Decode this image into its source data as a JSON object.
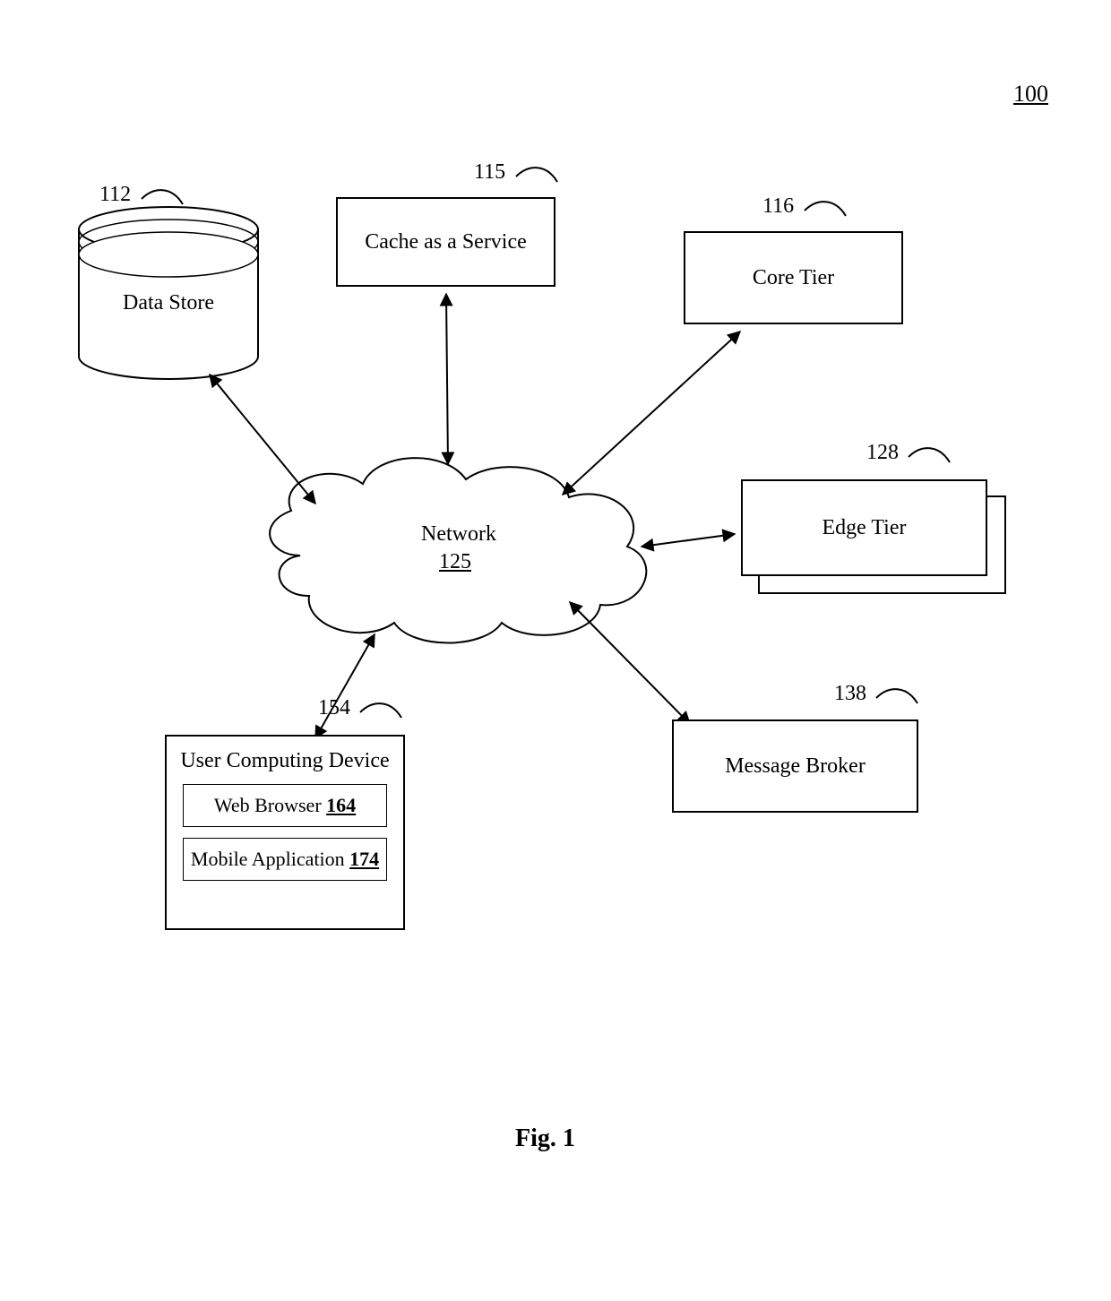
{
  "figure_ref": "100",
  "caption": "Fig. 1",
  "network": {
    "label": "Network",
    "ref": "125"
  },
  "nodes": {
    "data_store": {
      "ref": "112",
      "label": "Data Store"
    },
    "cache": {
      "ref": "115",
      "label": "Cache as a Service"
    },
    "core": {
      "ref": "116",
      "label": "Core Tier"
    },
    "edge": {
      "ref": "128",
      "label": "Edge Tier"
    },
    "broker": {
      "ref": "138",
      "label": "Message Broker"
    },
    "user_device": {
      "ref": "154",
      "label": "User Computing Device"
    },
    "web_browser": {
      "ref": "164",
      "label": "Web Browser"
    },
    "mobile_app": {
      "ref": "174",
      "label": "Mobile Application"
    }
  }
}
